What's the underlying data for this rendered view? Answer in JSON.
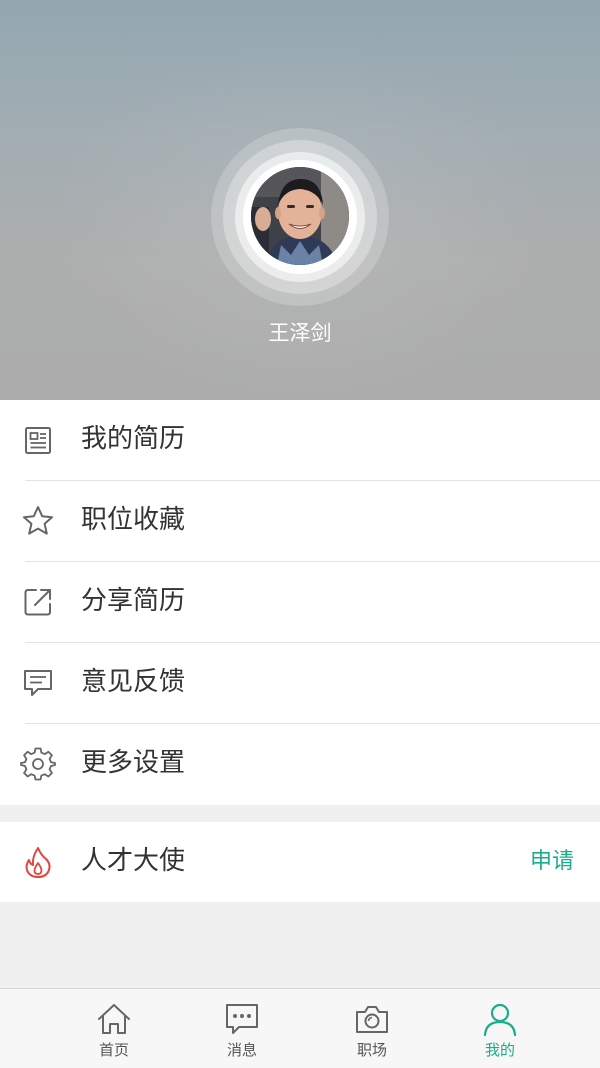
{
  "profile": {
    "name": "王泽剑"
  },
  "menu": {
    "items": [
      {
        "label": "我的简历",
        "icon": "resume-icon"
      },
      {
        "label": "职位收藏",
        "icon": "star-icon"
      },
      {
        "label": "分享简历",
        "icon": "share-icon"
      },
      {
        "label": "意见反馈",
        "icon": "feedback-icon"
      },
      {
        "label": "更多设置",
        "icon": "gear-icon"
      }
    ]
  },
  "ambassador": {
    "label": "人才大使",
    "icon": "flame-icon",
    "action_label": "申请"
  },
  "tabbar": {
    "tabs": [
      {
        "label": "首页",
        "icon": "home-icon",
        "active": false
      },
      {
        "label": "消息",
        "icon": "message-icon",
        "active": false
      },
      {
        "label": "职场",
        "icon": "camera-icon",
        "active": false
      },
      {
        "label": "我的",
        "icon": "person-icon",
        "active": true
      }
    ]
  },
  "colors": {
    "accent": "#1aad8b",
    "flame": "#e0463f",
    "text": "#333333",
    "icon_gray": "#666666"
  }
}
